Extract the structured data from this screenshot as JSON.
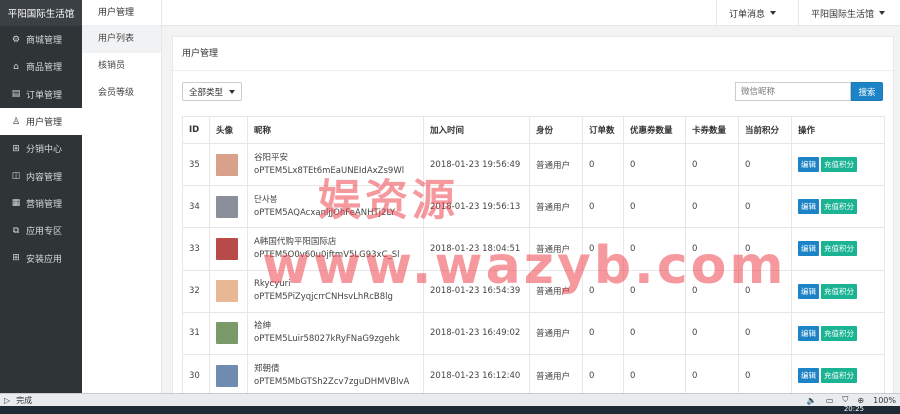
{
  "sidebar": {
    "brand": "平阳国际生活馆",
    "items": [
      {
        "label": "商城管理",
        "icon": "settings-icon"
      },
      {
        "label": "商品管理",
        "icon": "shop-icon"
      },
      {
        "label": "订单管理",
        "icon": "order-icon"
      },
      {
        "label": "用户管理",
        "icon": "user-icon"
      },
      {
        "label": "分销中心",
        "icon": "distribution-icon"
      },
      {
        "label": "内容管理",
        "icon": "content-icon"
      },
      {
        "label": "营销管理",
        "icon": "marketing-icon"
      },
      {
        "label": "应用专区",
        "icon": "app-icon"
      },
      {
        "label": "安装应用",
        "icon": "install-icon"
      }
    ]
  },
  "subnav": {
    "title": "用户管理",
    "items": [
      "用户列表",
      "核销员",
      "会员等级"
    ]
  },
  "topbar": {
    "orders_msg": "订单消息",
    "shop_name": "平阳国际生活馆"
  },
  "panel": {
    "title": "用户管理",
    "filter": "全部类型",
    "search_placeholder": "微信昵称",
    "search_button": "搜索"
  },
  "table": {
    "headers": [
      "ID",
      "头像",
      "昵称",
      "加入时间",
      "身份",
      "订单数",
      "优惠券数量",
      "卡券数量",
      "当前积分",
      "操作"
    ],
    "edit_label": "编辑",
    "credit_label": "充值积分",
    "rows": [
      {
        "id": "35",
        "nickname": "谷阳平安",
        "openid": "oPTEM5Lx8TEt6mEaUNEIdAxZs9Wl",
        "joined": "2018-01-23 19:56:49",
        "role": "普通用户",
        "orders": "0",
        "coupons": "0",
        "cards": "0",
        "points": "0",
        "avatar_color": "#d9a08a"
      },
      {
        "id": "34",
        "nickname": "단사봉",
        "openid": "oPTEM5AQAcxanljJOhFeANHTj2LY",
        "joined": "2018-01-23 19:56:13",
        "role": "普通用户",
        "orders": "0",
        "coupons": "0",
        "cards": "0",
        "points": "0",
        "avatar_color": "#8a8f99"
      },
      {
        "id": "33",
        "nickname": "A韩国代购平阳国际店",
        "openid": "oPTEM5O0v60u0jftmV5LG93xC_Sl",
        "joined": "2018-01-23 18:04:51",
        "role": "普通用户",
        "orders": "0",
        "coupons": "0",
        "cards": "0",
        "points": "0",
        "avatar_color": "#b84a4a"
      },
      {
        "id": "32",
        "nickname": "Rkycyuri",
        "openid": "oPTEM5PiZyqjcrrCNHsvLhRcB8lg",
        "joined": "2018-01-23 16:54:39",
        "role": "普通用户",
        "orders": "0",
        "coupons": "0",
        "cards": "0",
        "points": "0",
        "avatar_color": "#e8b796"
      },
      {
        "id": "31",
        "nickname": "袷绅",
        "openid": "oPTEM5Luir58027kRyFNaG9zgehk",
        "joined": "2018-01-23 16:49:02",
        "role": "普通用户",
        "orders": "0",
        "coupons": "0",
        "cards": "0",
        "points": "0",
        "avatar_color": "#7a9a6a"
      },
      {
        "id": "30",
        "nickname": "郑朝倩",
        "openid": "oPTEM5MbGTSh2Zcv7zguDHMVBlvA",
        "joined": "2018-01-23 16:12:40",
        "role": "普通用户",
        "orders": "0",
        "coupons": "0",
        "cards": "0",
        "points": "0",
        "avatar_color": "#6f8bb0"
      }
    ]
  },
  "watermark": {
    "line1": "娱资源",
    "line2": "www.wazyb.com"
  },
  "statusbar": {
    "status": "完成",
    "zoom": "100%"
  },
  "taskbar": {
    "clock": "20:25"
  }
}
